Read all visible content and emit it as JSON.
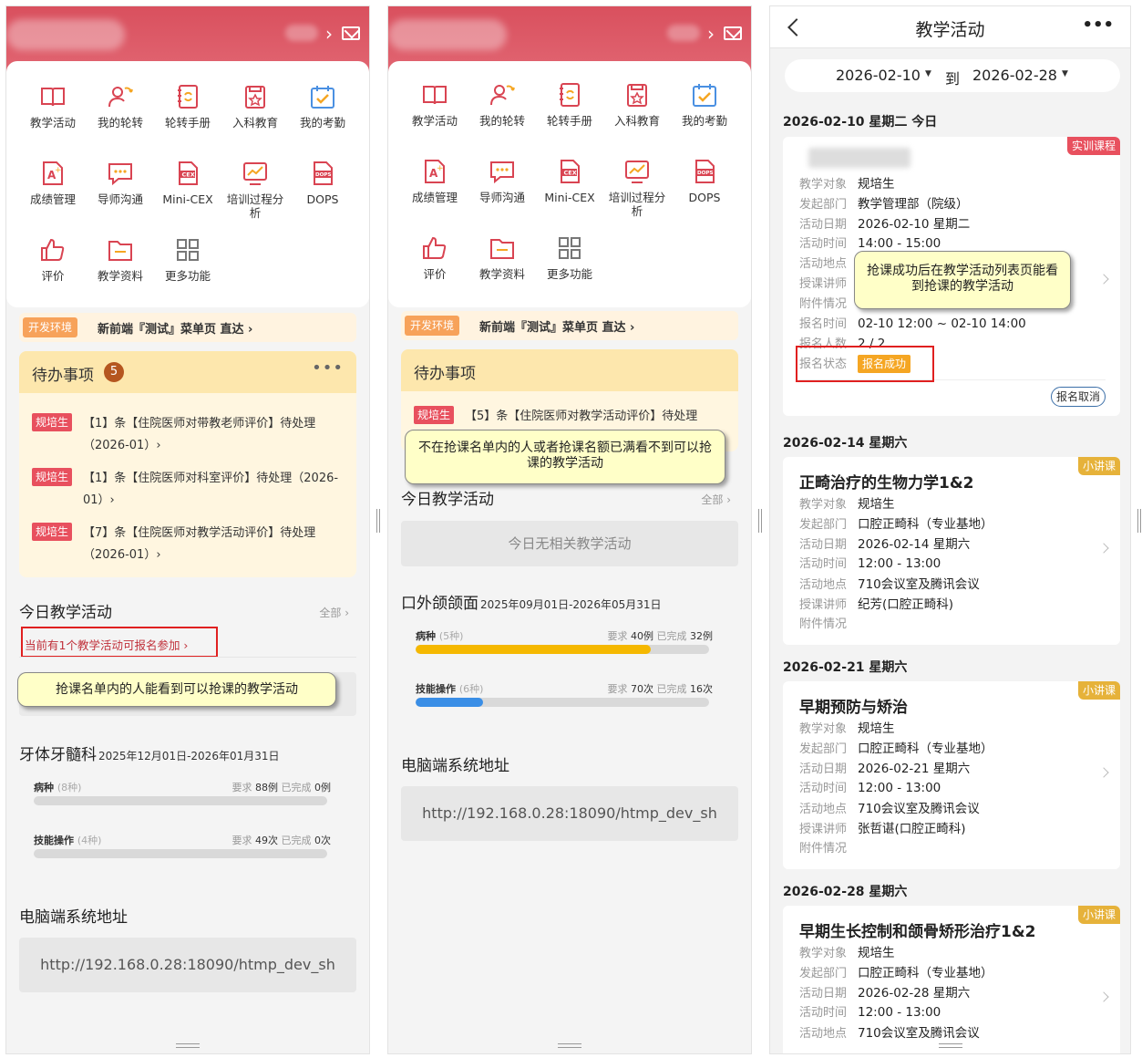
{
  "home": {
    "menu": [
      {
        "label": "教学活动",
        "icon": "book-icon"
      },
      {
        "label": "我的轮转",
        "icon": "rotation-user-icon"
      },
      {
        "label": "轮转手册",
        "icon": "manual-icon"
      },
      {
        "label": "入科教育",
        "icon": "education-icon"
      },
      {
        "label": "我的考勤",
        "icon": "calendar-check-icon"
      },
      {
        "label": "成绩管理",
        "icon": "grade-icon"
      },
      {
        "label": "导师沟通",
        "icon": "chat-icon"
      },
      {
        "label": "Mini-CEX",
        "icon": "cex-icon"
      },
      {
        "label": "培训过程分析",
        "icon": "chart-icon"
      },
      {
        "label": "DOPS",
        "icon": "dops-icon"
      },
      {
        "label": "评价",
        "icon": "thumbs-up-icon"
      },
      {
        "label": "教学资料",
        "icon": "folder-icon"
      },
      {
        "label": "更多功能",
        "icon": "grid-icon"
      }
    ],
    "env_tag": "开发环境",
    "env_text": "新前端『测试』菜单页 直达 ›",
    "todo_title": "待办事项",
    "today_title": "今日教学活动",
    "all_label": "全部 ›",
    "pc_title": "电脑端系统地址",
    "pc_url": "http://192.168.0.28:18090/htmp_dev_sh"
  },
  "panel1": {
    "todo_count": "5",
    "todo_more": "•••",
    "todos": [
      {
        "tag": "规培生",
        "text": "【1】条【住院医师对带教老师评价】待处理（2026-01）›"
      },
      {
        "tag": "规培生",
        "text": "【1】条【住院医师对科室评价】待处理（2026-01）›"
      },
      {
        "tag": "规培生",
        "text": "【7】条【住院医师对教学活动评价】待处理（2026-01）›"
      }
    ],
    "signup_notice": "当前有1个教学活动可报名参加 ›",
    "note": "抢课名单内的人能看到可以抢课的教学活动",
    "dept_title": "牙体牙髓科",
    "dept_range": "2025年12月01日-2026年01月31日",
    "progress": [
      {
        "name": "病种",
        "kinds": "(8种)",
        "req_label": "要求",
        "req": "88例",
        "done_label": "已完成",
        "done": "0例",
        "percent": 0,
        "color": "#f5b800"
      },
      {
        "name": "技能操作",
        "kinds": "(4种)",
        "req_label": "要求",
        "req": "49次",
        "done_label": "已完成",
        "done": "0次",
        "percent": 0,
        "color": "#3a8ee6"
      }
    ]
  },
  "panel2": {
    "todos": [
      {
        "tag": "规培生",
        "text": "【5】条【住院医师对教学活动评价】待处理"
      }
    ],
    "note": "不在抢课名单内的人或者抢课名额已满看不到可以抢课的教学活动",
    "no_activity": "今日无相关教学活动",
    "dept_title": "口外颌颌面",
    "dept_range": "2025年09月01日-2026年05月31日",
    "progress": [
      {
        "name": "病种",
        "kinds": "(5种)",
        "req_label": "要求",
        "req": "40例",
        "done_label": "已完成",
        "done": "32例",
        "percent": 80,
        "color": "#f5b800"
      },
      {
        "name": "技能操作",
        "kinds": "(6种)",
        "req_label": "要求",
        "req": "70次",
        "done_label": "已完成",
        "done": "16次",
        "percent": 23,
        "color": "#3a8ee6"
      }
    ]
  },
  "panel3": {
    "title": "教学活动",
    "more": "•••",
    "date_from": "2026-02-10",
    "date_to_label": "到",
    "date_to": "2026-02-28",
    "caret": "▼",
    "note": "抢课成功后在教学活动列表页能看到抢课的教学活动",
    "cancel_label": "报名取消",
    "status_label": "报名状态",
    "status_value": "报名成功",
    "days": [
      {
        "head": "2026-02-10 星期二 今日",
        "tag": "实训课程",
        "tag_color": "#e8505e",
        "title": "",
        "rows": [
          {
            "k": "教学对象",
            "v": "规培生"
          },
          {
            "k": "发起部门",
            "v": "教学管理部（院级）"
          },
          {
            "k": "活动日期",
            "v": "2026-02-10 星期二"
          },
          {
            "k": "活动时间",
            "v": "14:00 - 15:00"
          },
          {
            "k": "活动地点",
            "v": ""
          },
          {
            "k": "授课讲师",
            "v": ""
          },
          {
            "k": "附件情况",
            "v": ""
          },
          {
            "k": "报名时间",
            "v": "02-10 12:00 ~ 02-10 14:00"
          },
          {
            "k": "报名人数",
            "v": "2 / 2"
          }
        ]
      },
      {
        "head": "2026-02-14 星期六",
        "tag": "小讲课",
        "tag_color": "#e6b23a",
        "title": "正畸治疗的生物力学1&2",
        "rows": [
          {
            "k": "教学对象",
            "v": "规培生"
          },
          {
            "k": "发起部门",
            "v": "口腔正畸科（专业基地）"
          },
          {
            "k": "活动日期",
            "v": "2026-02-14 星期六"
          },
          {
            "k": "活动时间",
            "v": "12:00 - 13:00"
          },
          {
            "k": "活动地点",
            "v": "710会议室及腾讯会议"
          },
          {
            "k": "授课讲师",
            "v": "纪芳(口腔正畸科)"
          },
          {
            "k": "附件情况",
            "v": ""
          }
        ]
      },
      {
        "head": "2026-02-21 星期六",
        "tag": "小讲课",
        "tag_color": "#e6b23a",
        "title": "早期预防与矫治",
        "rows": [
          {
            "k": "教学对象",
            "v": "规培生"
          },
          {
            "k": "发起部门",
            "v": "口腔正畸科（专业基地）"
          },
          {
            "k": "活动日期",
            "v": "2026-02-21 星期六"
          },
          {
            "k": "活动时间",
            "v": "12:00 - 13:00"
          },
          {
            "k": "活动地点",
            "v": "710会议室及腾讯会议"
          },
          {
            "k": "授课讲师",
            "v": "张哲谌(口腔正畸科)"
          },
          {
            "k": "附件情况",
            "v": ""
          }
        ]
      },
      {
        "head": "2026-02-28 星期六",
        "tag": "小讲课",
        "tag_color": "#e6b23a",
        "title": "早期生长控制和颌骨矫形治疗1&2",
        "rows": [
          {
            "k": "教学对象",
            "v": "规培生"
          },
          {
            "k": "发起部门",
            "v": "口腔正畸科（专业基地）"
          },
          {
            "k": "活动日期",
            "v": "2026-02-28 星期六"
          },
          {
            "k": "活动时间",
            "v": "12:00 - 13:00"
          },
          {
            "k": "活动地点",
            "v": "710会议室及腾讯会议"
          }
        ]
      }
    ]
  }
}
